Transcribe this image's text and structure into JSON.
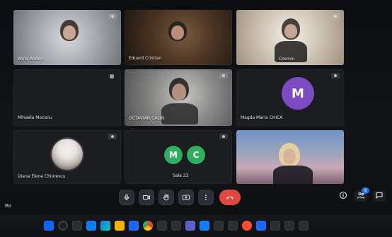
{
  "meeting": {
    "participants": [
      {
        "name": "Alina Andrei",
        "tile": "video1",
        "corner": true
      },
      {
        "name": "Eduard Cristian",
        "tile": "video2",
        "corner": false
      },
      {
        "name": "Cosmin",
        "tile": "video3",
        "corner": true
      },
      {
        "name": "Mihaela Mocanu",
        "tile": "dark",
        "corner": true
      },
      {
        "name": "OCTAVIAN CALIN",
        "tile": "video4",
        "corner": true
      },
      {
        "name": "Magda Maria CHICA",
        "tile": "dark",
        "corner": true,
        "avatar_letter": "M",
        "avatar_color": "#7c4bc2"
      },
      {
        "name": "Diana Elena Chiorescu",
        "tile": "dark",
        "corner": true
      },
      {
        "name": "Sala 23",
        "tile": "dark",
        "corner": true,
        "avatars": [
          "M",
          "C"
        ],
        "avatar_color": "#2fae5f"
      },
      {
        "name": "",
        "tile": "video5",
        "corner": false
      }
    ],
    "controls": [
      {
        "name": "microphone",
        "icon": "mic-icon"
      },
      {
        "name": "camera",
        "icon": "camera-icon"
      },
      {
        "name": "raise-hand",
        "icon": "hand-icon"
      },
      {
        "name": "present",
        "icon": "present-icon"
      },
      {
        "name": "more-options",
        "icon": "more-icon"
      },
      {
        "name": "leave",
        "icon": "phone-hangup-icon"
      }
    ],
    "right_icons": [
      {
        "name": "info",
        "icon": "info-icon"
      },
      {
        "name": "people",
        "icon": "people-icon",
        "badge": "9"
      },
      {
        "name": "chat",
        "icon": "chat-icon"
      }
    ],
    "bottom_left_text": "Ro"
  },
  "taskbar": {
    "clock_time": "",
    "clock_date": ""
  },
  "colors": {
    "accent_purple": "#7c4bc2",
    "accent_green": "#2fae5f",
    "leave_red": "#e2463f",
    "badge_blue": "#1a73e8"
  }
}
